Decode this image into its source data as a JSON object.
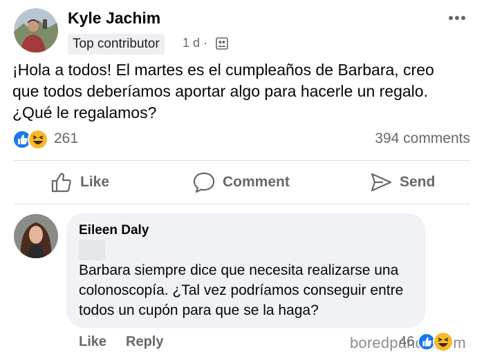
{
  "post": {
    "author": "Kyle Jachim",
    "badge": "Top contributor",
    "time": "1 d ·",
    "audience_icon": "friends-icon",
    "lines": [
      "¡Hola a todos! El martes es el cumpleaños de Barbara, creo",
      "que todos deberíamos aportar algo para hacerle un regalo.",
      "¿Qué le regalamos?"
    ],
    "reaction_count": "261",
    "comments_count": "394 comments"
  },
  "actions": {
    "like": "Like",
    "comment": "Comment",
    "send": "Send"
  },
  "comment": {
    "author": "Eileen Daly",
    "lines": [
      "Barbara siempre dice que necesita realizarse una",
      "colonoscopía. ¿Tal vez podríamos conseguir entre",
      "todos un cupón para que se la haga?"
    ],
    "like": "Like",
    "reply": "Reply",
    "reaction_count": "46"
  },
  "watermark": "boredpanda.com",
  "colors": {
    "like_blue": "#1877f2",
    "haha_yellow": "#f7b928",
    "secondary_text": "#65676b",
    "bubble_bg": "#f0f2f5"
  }
}
